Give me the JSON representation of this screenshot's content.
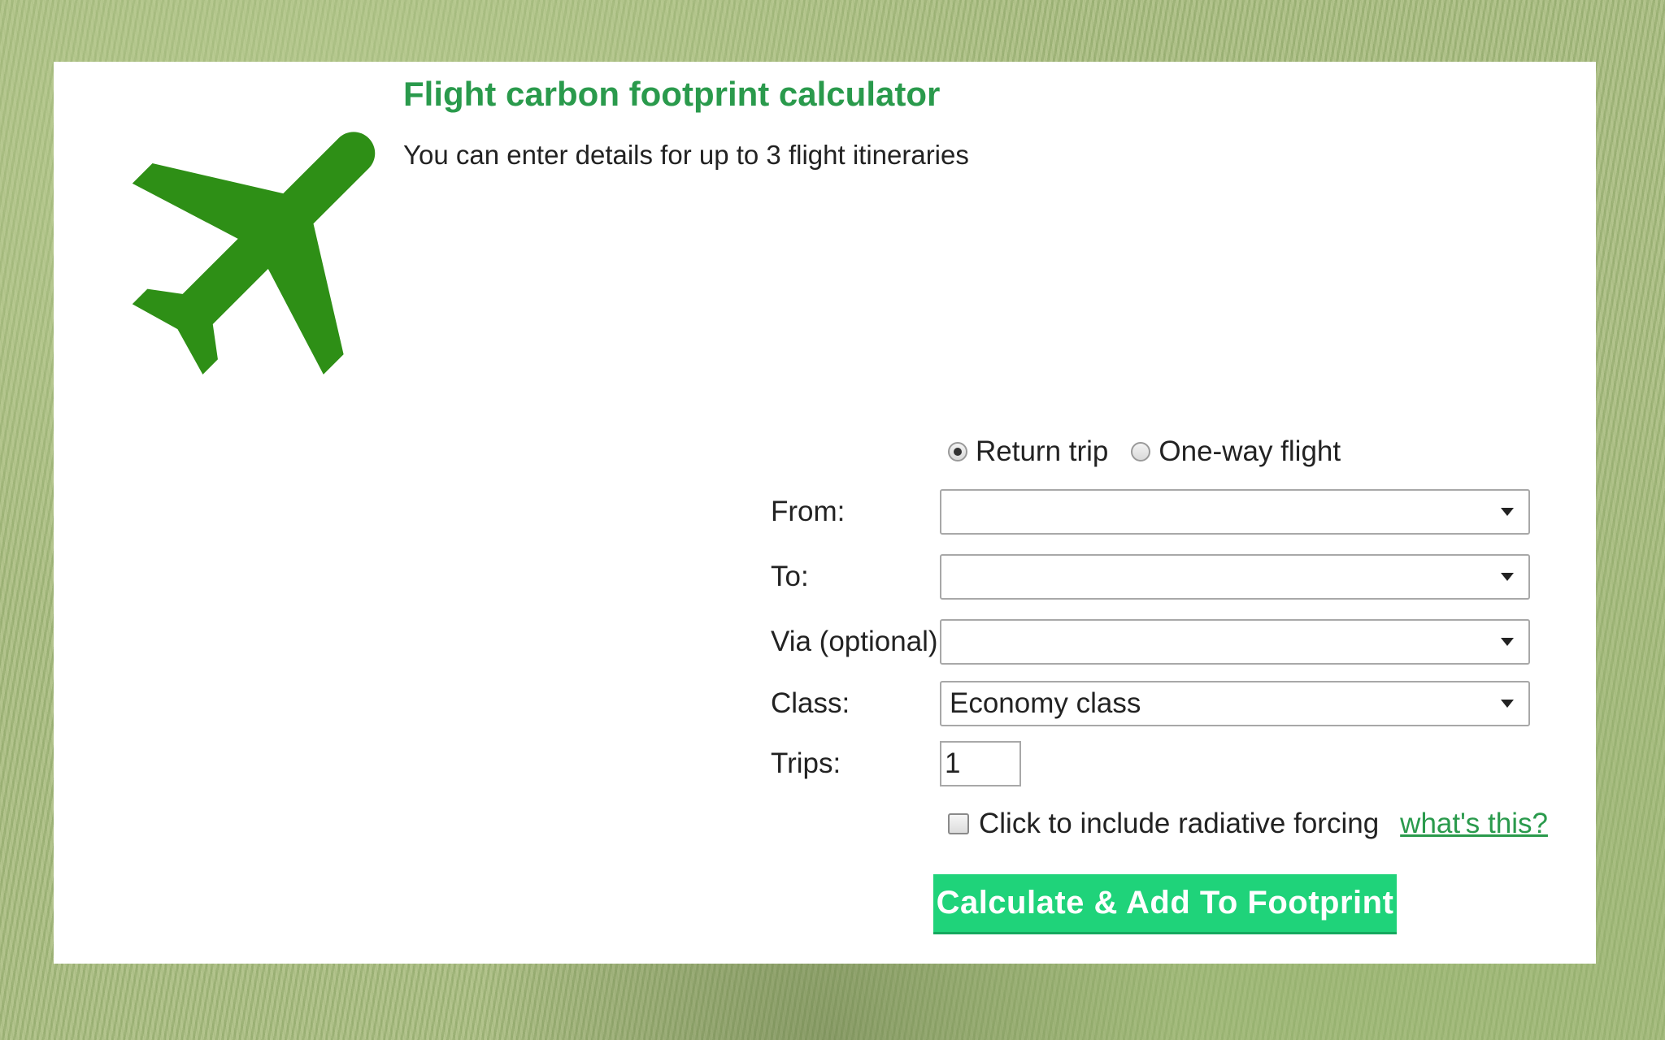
{
  "header": {
    "title": "Flight carbon footprint calculator",
    "subtitle": "You can enter details for up to 3 flight itineraries"
  },
  "trip_type": {
    "options": [
      {
        "label": "Return trip",
        "selected": true
      },
      {
        "label": "One-way flight",
        "selected": false
      }
    ]
  },
  "form": {
    "from_label": "From:",
    "from_value": "",
    "to_label": "To:",
    "to_value": "",
    "via_label": "Via (optional):",
    "via_value": "",
    "class_label": "Class:",
    "class_value": "Economy class",
    "trips_label": "Trips:",
    "trips_value": "1",
    "radiative_forcing_label": "Click to include radiative forcing",
    "radiative_forcing_checked": false,
    "whats_this_link": "what's this?"
  },
  "actions": {
    "calculate_label": "Calculate & Add To Footprint"
  },
  "colors": {
    "brand_green": "#2a9a4c",
    "plane_green": "#2e8f16",
    "button_green": "#1fd37a"
  },
  "icons": {
    "plane": "airplane-icon"
  }
}
